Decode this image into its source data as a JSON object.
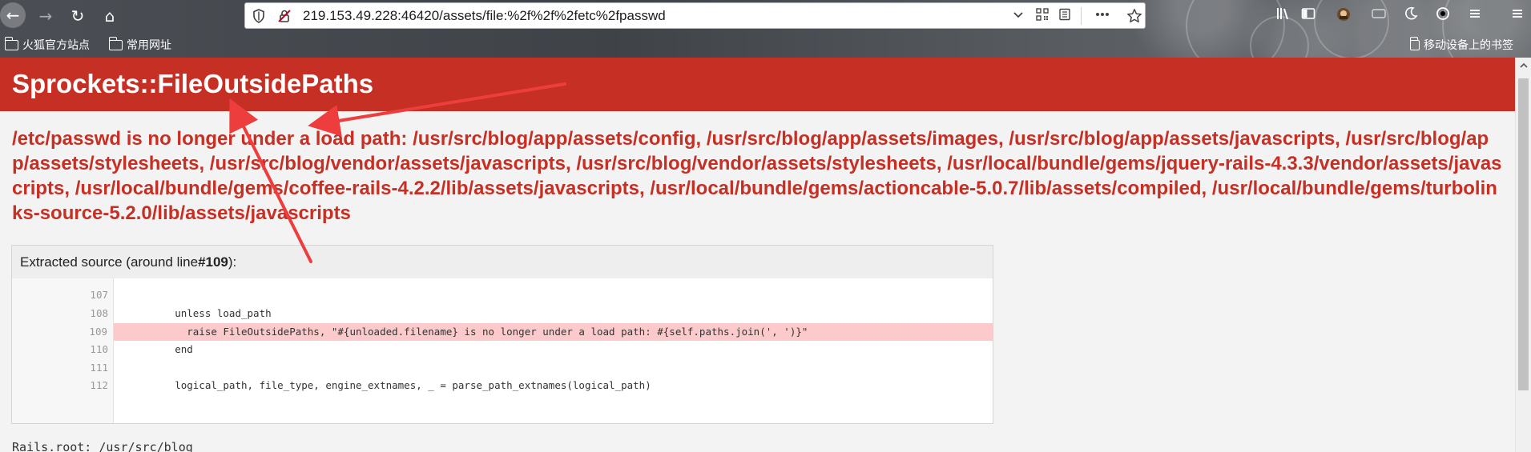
{
  "browser": {
    "nav": {
      "back_glyph": "←",
      "forward_glyph": "→",
      "reload_glyph": "↻",
      "home_glyph": "⌂"
    },
    "url": "219.153.49.228:46420/assets/file:%2f%2f%2fetc%2fpasswd",
    "url_icons": {
      "shield": "shield-icon",
      "insecure": "insecure-lock-icon",
      "chevron": "chevron-down-icon",
      "qr": "qr-code-icon",
      "reader": "reader-view-icon",
      "more": "more-icon",
      "star": "bookmark-star-icon"
    },
    "bookmarks": [
      {
        "label": "火狐官方站点"
      },
      {
        "label": "常用网址"
      }
    ],
    "mobile_bookmarks": "移动设备上的书签"
  },
  "page": {
    "title": "Sprockets::FileOutsidePaths",
    "message": "/etc/passwd is no longer under a load path: /usr/src/blog/app/assets/config, /usr/src/blog/app/assets/images, /usr/src/blog/app/assets/javascripts, /usr/src/blog/app/assets/stylesheets, /usr/src/blog/vendor/assets/javascripts, /usr/src/blog/vendor/assets/stylesheets, /usr/local/bundle/gems/jquery-rails-4.3.3/vendor/assets/javascripts, /usr/local/bundle/gems/coffee-rails-4.2.2/lib/assets/javascripts, /usr/local/bundle/gems/actioncable-5.0.7/lib/assets/compiled, /usr/local/bundle/gems/turbolinks-source-5.2.0/lib/assets/javascripts",
    "source": {
      "header_prefix": "Extracted source (around line ",
      "header_line": "#109",
      "header_suffix": "):",
      "lines": [
        {
          "no": "107",
          "code": ""
        },
        {
          "no": "108",
          "code": "        unless load_path"
        },
        {
          "no": "109",
          "code": "          raise FileOutsidePaths, \"#{unloaded.filename} is no longer under a load path: #{self.paths.join(', ')}\""
        },
        {
          "no": "110",
          "code": "        end"
        },
        {
          "no": "111",
          "code": ""
        },
        {
          "no": "112",
          "code": "        logical_path, file_type, engine_extnames, _ = parse_path_extnames(logical_path)"
        }
      ]
    },
    "rails_root": "Rails.root: /usr/src/blog"
  },
  "colors": {
    "error_red": "#c52f24",
    "highlight": "#fccaca",
    "annotation_arrow": "#ee3d3d"
  }
}
